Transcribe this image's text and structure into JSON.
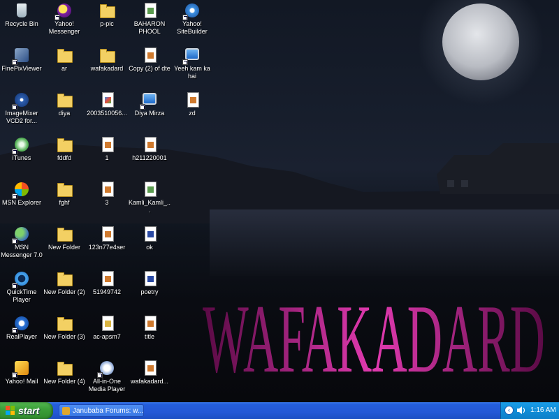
{
  "colors": {
    "sky": "#141a26",
    "moon": "#c8cbd0",
    "wafakadard_text": "#c11d8f",
    "taskbar_blue": "#245edc",
    "start_green": "#3c9f3a",
    "tray_blue": "#0d8ad8"
  },
  "wallpaper": {
    "text": "WAFAKADARD"
  },
  "desktop_icons": [
    {
      "label": "Recycle Bin",
      "icon": "recycle-bin-icon"
    },
    {
      "label": "FinePixViewer",
      "icon": "finepix-viewer-icon"
    },
    {
      "label": "ImageMixer VCD2 for...",
      "icon": "imagemixer-icon"
    },
    {
      "label": "iTunes",
      "icon": "itunes-icon"
    },
    {
      "label": "MSN Explorer",
      "icon": "msn-explorer-icon"
    },
    {
      "label": "MSN Messenger 7.0",
      "icon": "msn-messenger-icon"
    },
    {
      "label": "QuickTime Player",
      "icon": "quicktime-icon"
    },
    {
      "label": "RealPlayer",
      "icon": "realplayer-icon"
    },
    {
      "label": "Yahoo! Mail",
      "icon": "yahoo-mail-icon"
    },
    {
      "label": "Yahoo! Messenger",
      "icon": "yahoo-messenger-icon"
    },
    {
      "label": "ar",
      "icon": "folder-icon"
    },
    {
      "label": "diya",
      "icon": "folder-icon"
    },
    {
      "label": "fddfd",
      "icon": "folder-icon"
    },
    {
      "label": "fghf",
      "icon": "folder-icon"
    },
    {
      "label": "New Folder",
      "icon": "folder-icon"
    },
    {
      "label": "New Folder (2)",
      "icon": "folder-icon"
    },
    {
      "label": "New Folder (3)",
      "icon": "folder-icon"
    },
    {
      "label": "New Folder (4)",
      "icon": "folder-icon"
    },
    {
      "label": "p-pic",
      "icon": "folder-icon"
    },
    {
      "label": "wafakadard",
      "icon": "folder-icon"
    },
    {
      "label": "2003510056...",
      "icon": "picture-file-icon"
    },
    {
      "label": "1",
      "icon": "media-file-icon"
    },
    {
      "label": "3",
      "icon": "media-file-icon"
    },
    {
      "label": "123n77e4ser",
      "icon": "media-file-icon"
    },
    {
      "label": "51949742",
      "icon": "media-file-icon"
    },
    {
      "label": "ac-apsm7",
      "icon": "zip-file-icon"
    },
    {
      "label": "All-in-One Media Player",
      "icon": "media-player-icon"
    },
    {
      "label": "BAHARON PHOOL",
      "icon": "mp3-file-icon"
    },
    {
      "label": "Copy (2) of dte",
      "icon": "media-file-icon"
    },
    {
      "label": "Diya Mirza",
      "icon": "monitor-icon"
    },
    {
      "label": "h211220001",
      "icon": "media-file-icon"
    },
    {
      "label": "Kamli_Kamli_...",
      "icon": "mp3-file-icon"
    },
    {
      "label": "ok",
      "icon": "word-document-icon"
    },
    {
      "label": "poetry",
      "icon": "word-document-icon"
    },
    {
      "label": "title",
      "icon": "media-file-icon"
    },
    {
      "label": "wafakadard...",
      "icon": "media-file-icon"
    },
    {
      "label": "Yahoo! SiteBuilder",
      "icon": "yahoo-sitebuilder-icon"
    },
    {
      "label": "Yeeh kam ka hai",
      "icon": "monitor-icon"
    },
    {
      "label": "zd",
      "icon": "media-file-icon"
    }
  ],
  "taskbar": {
    "start_label": "start",
    "task_button_label": "Janubaba Forums: w...",
    "clock": "1:16 AM"
  }
}
